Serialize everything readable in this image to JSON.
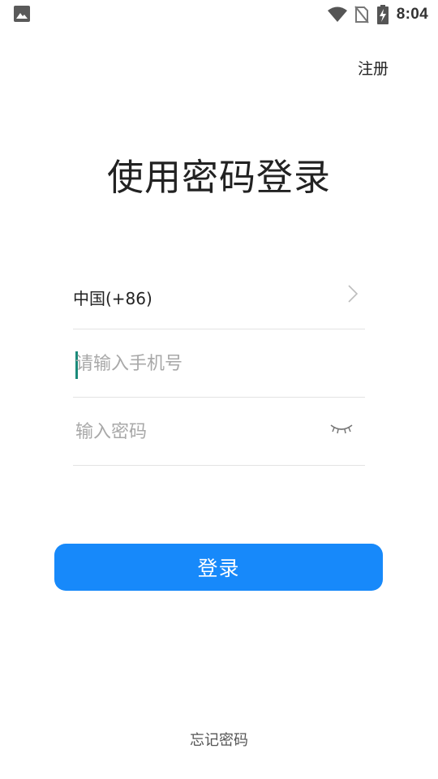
{
  "status_bar": {
    "time": "8:04",
    "icons": [
      "gallery-icon",
      "wifi-icon",
      "no-sim-icon",
      "battery-charging-icon"
    ]
  },
  "header": {
    "register_label": "注册"
  },
  "main": {
    "title": "使用密码登录",
    "country_code_label": "中国(+86)",
    "phone_input": {
      "placeholder": "请输入手机号",
      "value": ""
    },
    "password_input": {
      "placeholder": "输入密码",
      "value": ""
    },
    "login_button_label": "登录",
    "forgot_password_label": "忘记密码"
  },
  "colors": {
    "accent": "#1789fa",
    "cursor": "#1a8a7a",
    "divider": "#e3e3e3",
    "placeholder": "#a8a8a8"
  }
}
